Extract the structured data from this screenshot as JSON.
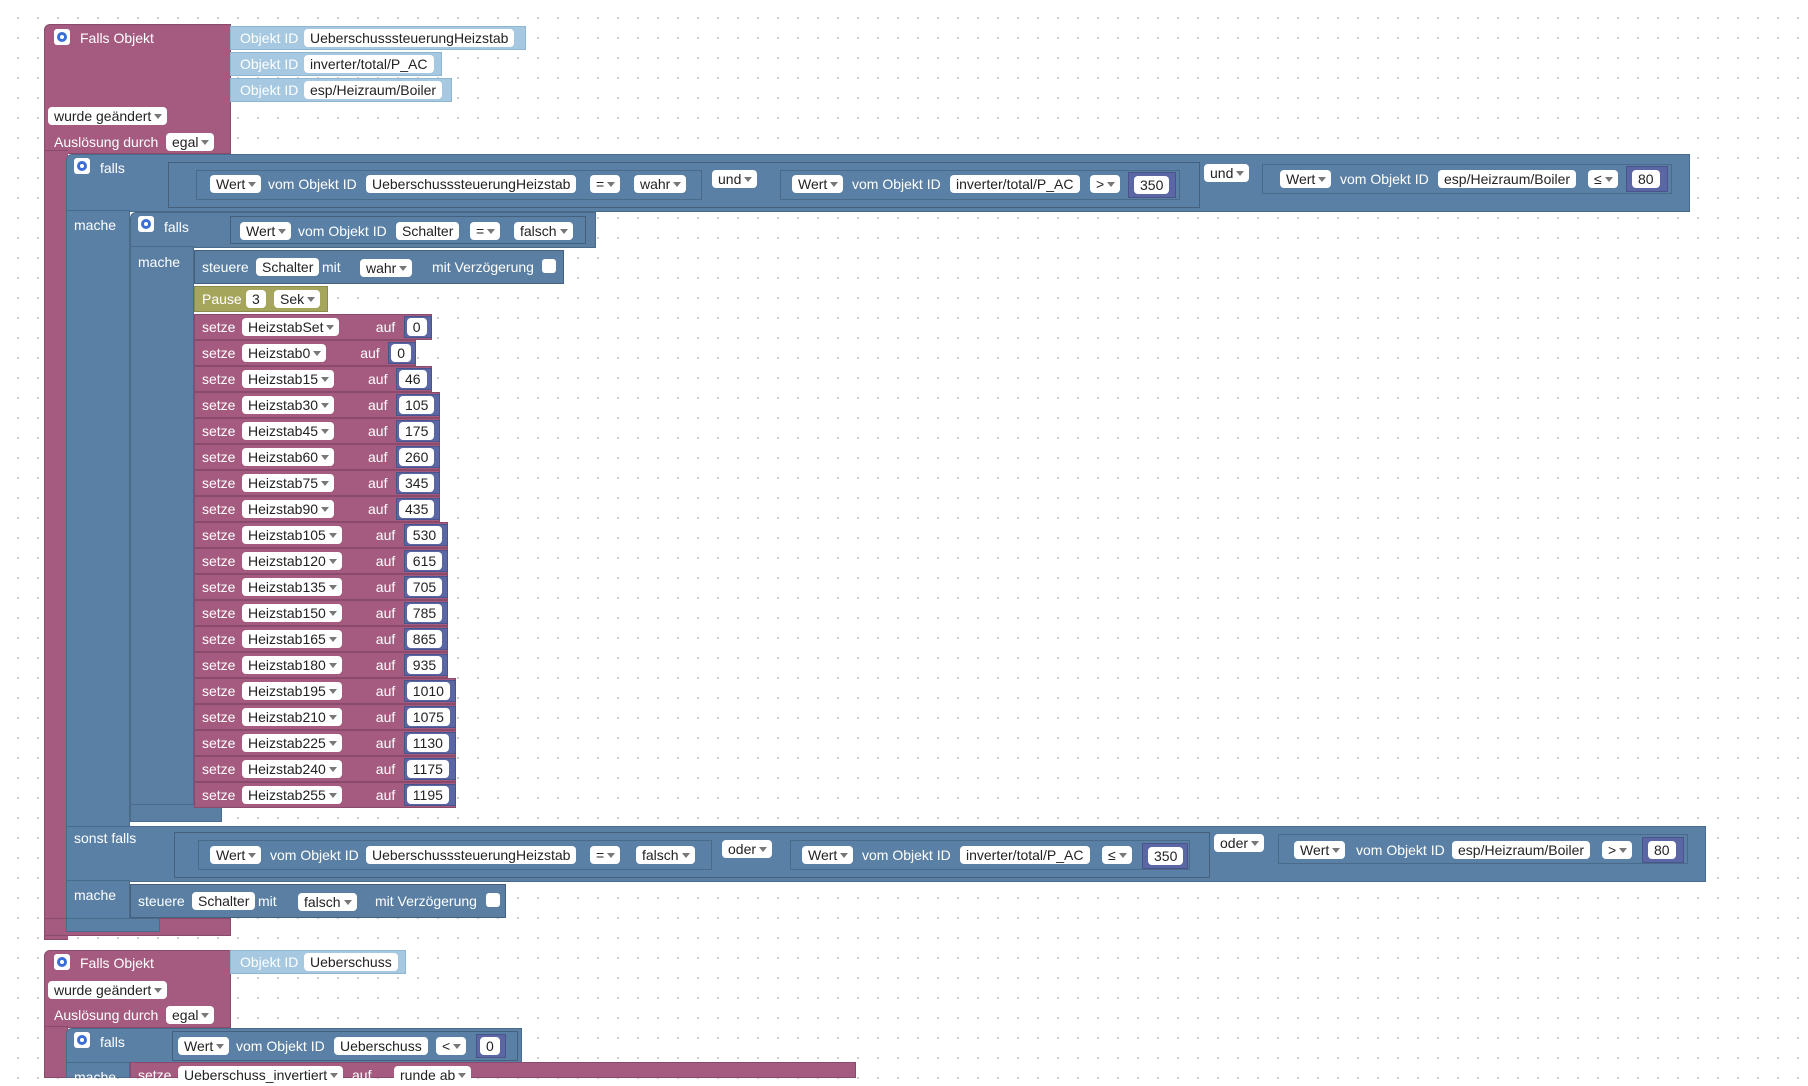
{
  "trigger1": {
    "title": "Falls Objekt",
    "objects": [
      {
        "label": "Objekt ID",
        "value": "UeberschusssteuerungHeizstab"
      },
      {
        "label": "Objekt ID",
        "value": "inverter/total/P_AC"
      },
      {
        "label": "Objekt ID",
        "value": "esp/Heizraum/Boiler"
      }
    ],
    "event": "wurde geändert",
    "ausloesung_label": "Auslösung durch",
    "ausloesung_value": "egal"
  },
  "if1": {
    "falls_label": "falls",
    "cond1": {
      "wert": "Wert",
      "vom": "vom Objekt ID",
      "obj": "UeberschusssteuerungHeizstab",
      "op": "=",
      "val": "wahr"
    },
    "und1": "und",
    "cond2": {
      "wert": "Wert",
      "vom": "vom Objekt ID",
      "obj": "inverter/total/P_AC",
      "op": ">",
      "val": "350"
    },
    "und2": "und",
    "cond3": {
      "wert": "Wert",
      "vom": "vom Objekt ID",
      "obj": "esp/Heizraum/Boiler",
      "op": "≤",
      "val": "80"
    },
    "mache_label": "mache",
    "inner_if": {
      "falls_label": "falls",
      "cond": {
        "wert": "Wert",
        "vom": "vom Objekt ID",
        "obj": "Schalter",
        "op": "=",
        "val": "falsch"
      },
      "mache_label": "mache",
      "steuere": {
        "label": "steuere",
        "obj": "Schalter",
        "mit": "mit",
        "val": "wahr",
        "delay": "mit Verzögerung"
      }
    },
    "pause": {
      "label": "Pause",
      "value": "3",
      "unit": "Sek"
    },
    "setze_label": "setze",
    "auf_label": "auf",
    "assignments": [
      {
        "var": "HeizstabSet",
        "value": "0"
      },
      {
        "var": "Heizstab0",
        "value": "0"
      },
      {
        "var": "Heizstab15",
        "value": "46"
      },
      {
        "var": "Heizstab30",
        "value": "105"
      },
      {
        "var": "Heizstab45",
        "value": "175"
      },
      {
        "var": "Heizstab60",
        "value": "260"
      },
      {
        "var": "Heizstab75",
        "value": "345"
      },
      {
        "var": "Heizstab90",
        "value": "435"
      },
      {
        "var": "Heizstab105",
        "value": "530"
      },
      {
        "var": "Heizstab120",
        "value": "615"
      },
      {
        "var": "Heizstab135",
        "value": "705"
      },
      {
        "var": "Heizstab150",
        "value": "785"
      },
      {
        "var": "Heizstab165",
        "value": "865"
      },
      {
        "var": "Heizstab180",
        "value": "935"
      },
      {
        "var": "Heizstab195",
        "value": "1010"
      },
      {
        "var": "Heizstab210",
        "value": "1075"
      },
      {
        "var": "Heizstab225",
        "value": "1130"
      },
      {
        "var": "Heizstab240",
        "value": "1175"
      },
      {
        "var": "Heizstab255",
        "value": "1195"
      }
    ],
    "sonst_falls_label": "sonst falls",
    "else_cond1": {
      "wert": "Wert",
      "vom": "vom Objekt ID",
      "obj": "UeberschusssteuerungHeizstab",
      "op": "=",
      "val": "falsch"
    },
    "oder1": "oder",
    "else_cond2": {
      "wert": "Wert",
      "vom": "vom Objekt ID",
      "obj": "inverter/total/P_AC",
      "op": "≤",
      "val": "350"
    },
    "oder2": "oder",
    "else_cond3": {
      "wert": "Wert",
      "vom": "vom Objekt ID",
      "obj": "esp/Heizraum/Boiler",
      "op": ">",
      "val": "80"
    },
    "else_mache_label": "mache",
    "else_steuere": {
      "label": "steuere",
      "obj": "Schalter",
      "mit": "mit",
      "val": "falsch",
      "delay": "mit Verzögerung"
    }
  },
  "trigger2": {
    "title": "Falls Objekt",
    "object": {
      "label": "Objekt ID",
      "value": "Ueberschuss"
    },
    "event": "wurde geändert",
    "ausloesung_label": "Auslösung durch",
    "ausloesung_value": "egal",
    "falls_label": "falls",
    "cond": {
      "wert": "Wert",
      "vom": "vom Objekt ID",
      "obj": "Ueberschuss",
      "op": "<",
      "val": "0"
    },
    "mache_label": "mache",
    "setze_label": "setze",
    "setze_var": "Ueberschuss_invertiert",
    "auf_label": "auf",
    "runde": "runde ab"
  }
}
